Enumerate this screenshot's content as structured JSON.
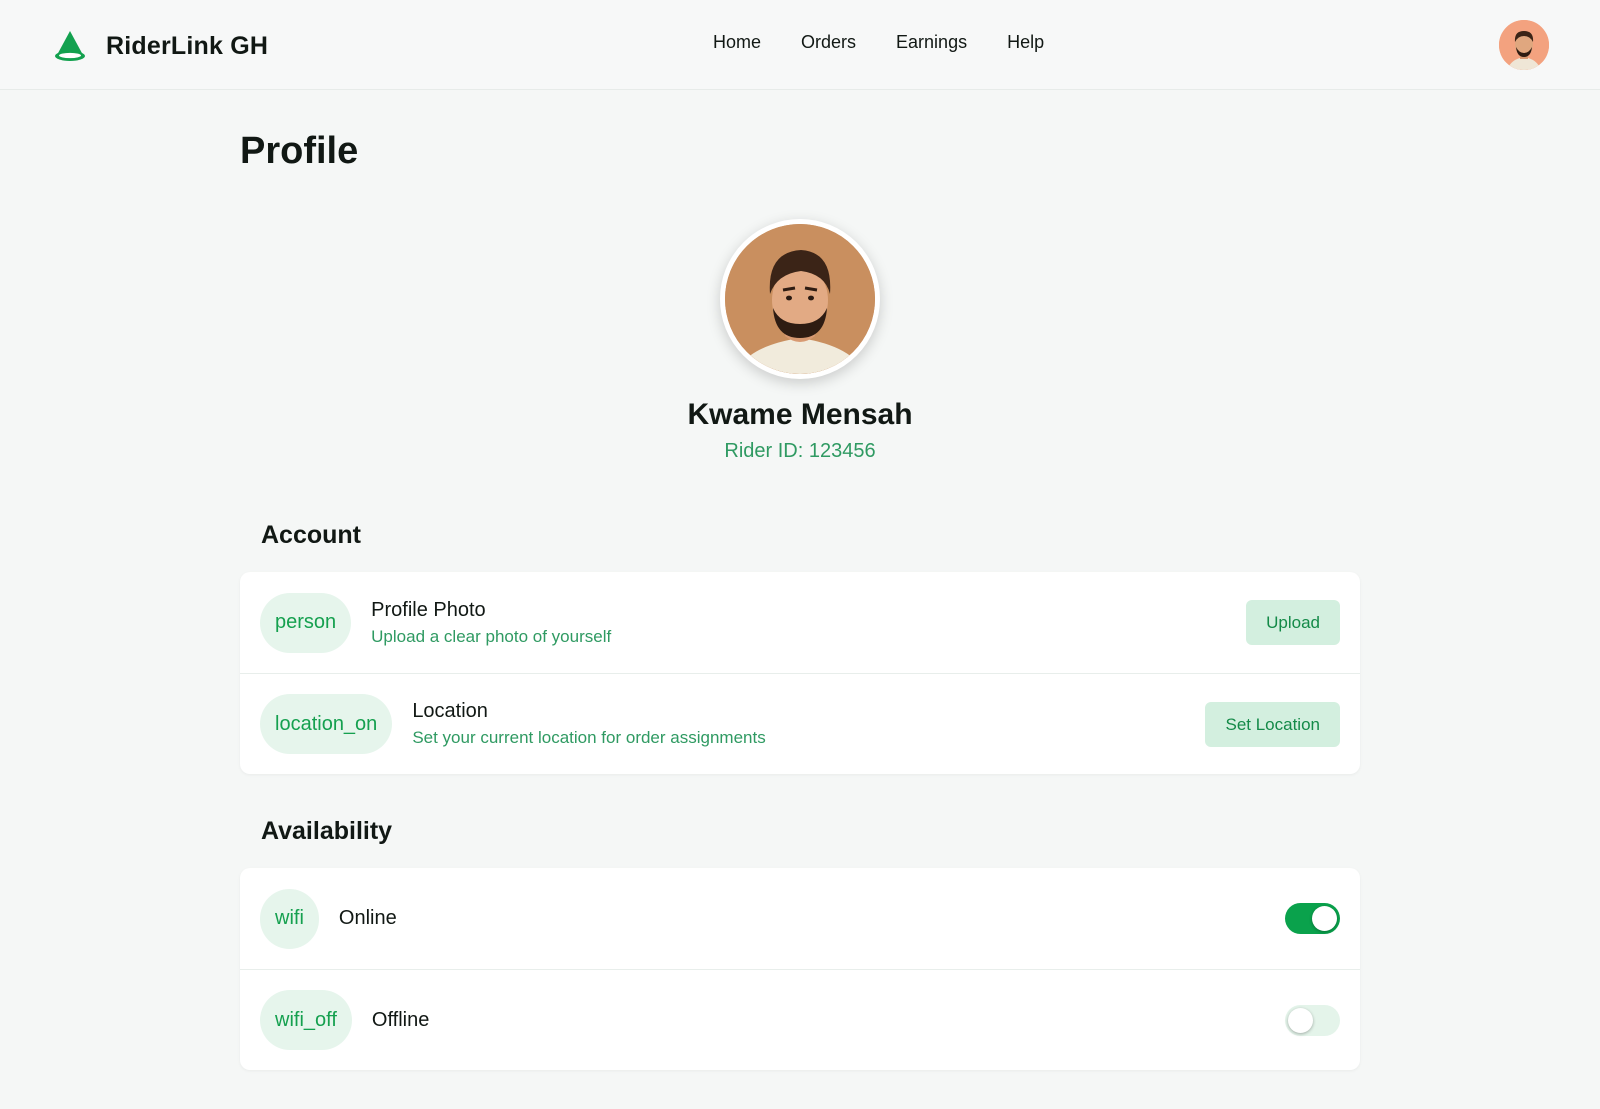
{
  "app": {
    "name": "RiderLink GH",
    "logo_icon": "cone-logo-icon",
    "brand_color": "#13a14f"
  },
  "nav": {
    "items": [
      "Home",
      "Orders",
      "Earnings",
      "Help"
    ]
  },
  "page": {
    "title": "Profile"
  },
  "profile": {
    "name": "Kwame Mensah",
    "rider_id": "Rider ID: 123456"
  },
  "account": {
    "heading": "Account",
    "rows": [
      {
        "icon": "person",
        "title": "Profile Photo",
        "subtitle": "Upload a clear photo of yourself",
        "action": "Upload"
      },
      {
        "icon": "location_on",
        "title": "Location",
        "subtitle": "Set your current location for order assignments",
        "action": "Set Location"
      }
    ]
  },
  "availability": {
    "heading": "Availability",
    "rows": [
      {
        "icon": "wifi",
        "label": "Online",
        "enabled": true
      },
      {
        "icon": "wifi_off",
        "label": "Offline",
        "enabled": false
      }
    ]
  },
  "colors": {
    "accent": "#13a14f",
    "accent_light": "#e6f5ec",
    "subtext": "#2f9a62",
    "background": "#f5f7f6"
  }
}
